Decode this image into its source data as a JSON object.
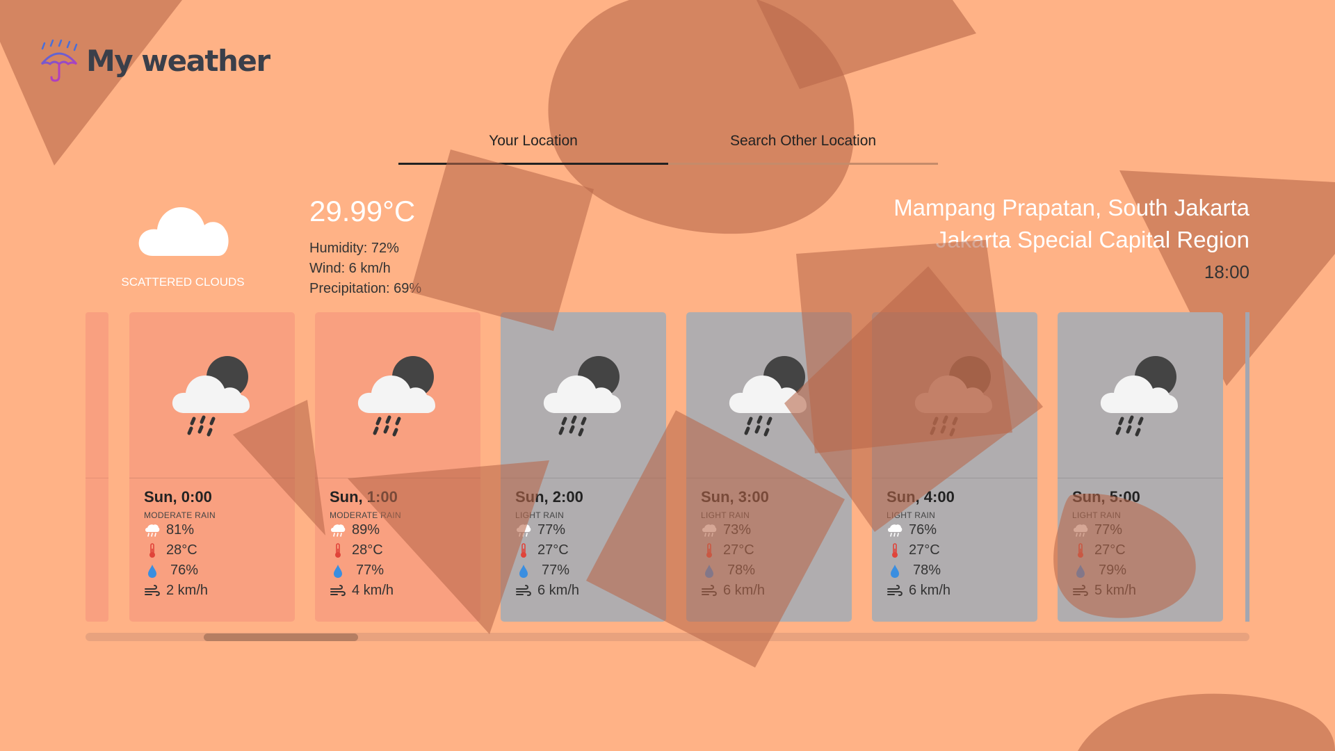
{
  "app": {
    "title": "My weather"
  },
  "tabs": [
    {
      "label": "Your Location",
      "active": true
    },
    {
      "label": "Search Other Location",
      "active": false
    }
  ],
  "current": {
    "icon": "cloud-icon",
    "description": "SCATTERED CLOUDS",
    "temperature": "29.99°C",
    "humidity": "Humidity: 72%",
    "wind": "Wind: 6 km/h",
    "precipitation": "Precipitation: 69%"
  },
  "location": {
    "line1": "Mampang Prapatan, South Jakarta",
    "line2": "Jakarta Special Capital Region",
    "time": "18:00"
  },
  "forecast": [
    {
      "title": "Sun, 0:00",
      "desc": "MODERATE RAIN",
      "rain": "81%",
      "temp": "28°C",
      "humidity": "76%",
      "wind": "2 km/h",
      "theme": "warm"
    },
    {
      "title": "Sun, 1:00",
      "desc": "MODERATE RAIN",
      "rain": "89%",
      "temp": "28°C",
      "humidity": "77%",
      "wind": "4 km/h",
      "theme": "warm"
    },
    {
      "title": "Sun, 2:00",
      "desc": "LIGHT RAIN",
      "rain": "77%",
      "temp": "27°C",
      "humidity": "77%",
      "wind": "6 km/h",
      "theme": "cool"
    },
    {
      "title": "Sun, 3:00",
      "desc": "LIGHT RAIN",
      "rain": "73%",
      "temp": "27°C",
      "humidity": "78%",
      "wind": "6 km/h",
      "theme": "cool"
    },
    {
      "title": "Sun, 4:00",
      "desc": "LIGHT RAIN",
      "rain": "76%",
      "temp": "27°C",
      "humidity": "78%",
      "wind": "6 km/h",
      "theme": "cool"
    },
    {
      "title": "Sun, 5:00",
      "desc": "LIGHT RAIN",
      "rain": "77%",
      "temp": "27°C",
      "humidity": "79%",
      "wind": "5 km/h",
      "theme": "cool"
    }
  ],
  "colors": {
    "background": "#FFB286",
    "warm_card": "#F9A080",
    "cool_card": "#B0ADAF",
    "shape": "#B8674A"
  }
}
